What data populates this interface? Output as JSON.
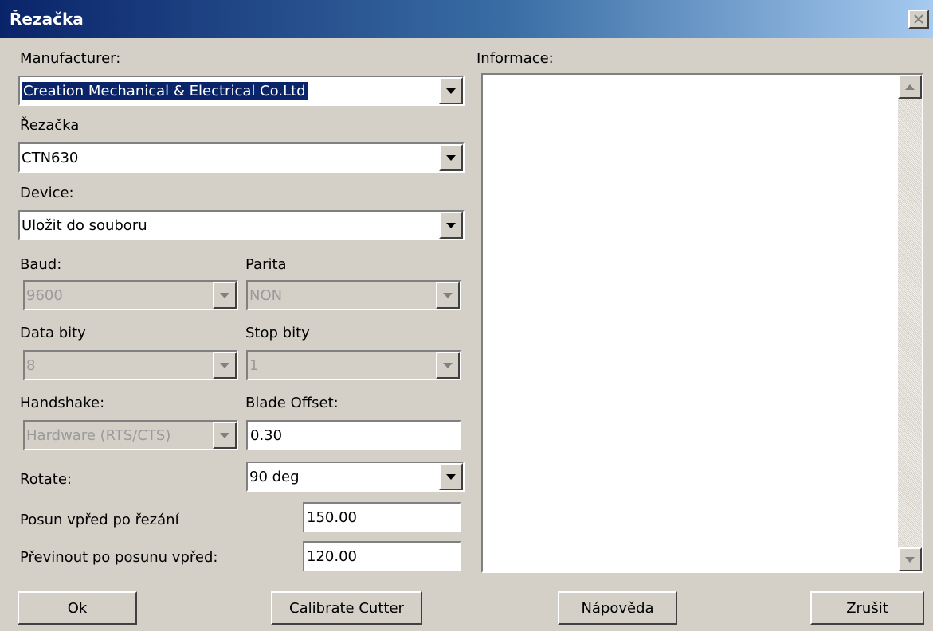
{
  "window": {
    "title": "Řezačka"
  },
  "manufacturer": {
    "label": "Manufacturer:",
    "value": "Creation Mechanical & Electrical Co.Ltd"
  },
  "cutter": {
    "label": "Řezačka",
    "value": "CTN630"
  },
  "device": {
    "label": "Device:",
    "value": "Uložit do souboru"
  },
  "baud": {
    "label": "Baud:",
    "value": "9600"
  },
  "parity": {
    "label": "Parita",
    "value": "NON"
  },
  "databits": {
    "label": "Data bity",
    "value": "8"
  },
  "stopbits": {
    "label": "Stop bity",
    "value": "1"
  },
  "handshake": {
    "label": "Handshake:",
    "value": "Hardware (RTS/CTS)"
  },
  "blade_offset": {
    "label": "Blade Offset:",
    "value": "0.30"
  },
  "rotate": {
    "label": "Rotate:",
    "value": "90 deg"
  },
  "feed_after_cut": {
    "label": "Posun vpřed po řezání",
    "value": "150.00"
  },
  "rewind_after_feed": {
    "label": "Převinout po posunu vpřed:",
    "value": "120.00"
  },
  "info": {
    "label": "Informace:",
    "text": ""
  },
  "buttons": {
    "ok": "Ok",
    "calibrate": "Calibrate Cutter",
    "help": "Nápověda",
    "cancel": "Zrušit"
  }
}
